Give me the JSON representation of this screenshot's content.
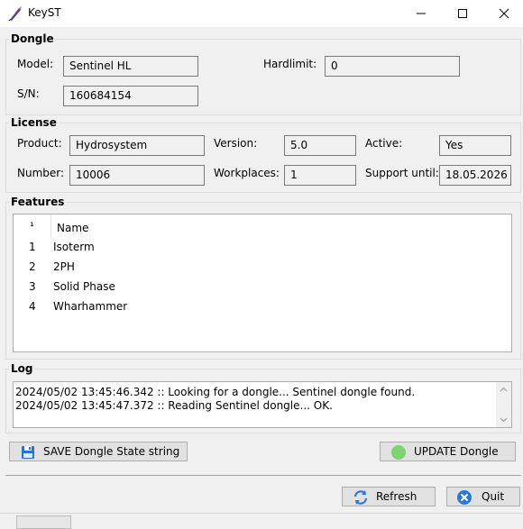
{
  "window": {
    "title": "KeyST",
    "app_icon": "quill-pen-icon",
    "controls": [
      "minimize-icon",
      "maximize-icon",
      "close-icon"
    ]
  },
  "dongle": {
    "legend": "Dongle",
    "model_label": "Model:",
    "model_value": "Sentinel HL",
    "sn_label": "S/N:",
    "sn_value": "160684154",
    "hardlimit_label": "Hardlimit:",
    "hardlimit_value": "0"
  },
  "license": {
    "legend": "License",
    "product_label": "Product:",
    "product_value": "Hydrosystem",
    "version_label": "Version:",
    "version_value": "5.0",
    "active_label": "Active:",
    "active_value": "Yes",
    "number_label": "Number:",
    "number_value": "10006",
    "workplaces_label": "Workplaces:",
    "workplaces_value": "1",
    "support_label": "Support until:",
    "support_value": "18.05.2026"
  },
  "features": {
    "legend": "Features",
    "columns": [
      "¹",
      "Name"
    ],
    "rows": [
      {
        "num": "1",
        "name": "Isoterm"
      },
      {
        "num": "2",
        "name": "2PH"
      },
      {
        "num": "3",
        "name": "Solid Phase"
      },
      {
        "num": "4",
        "name": "Wharhammer"
      }
    ]
  },
  "log": {
    "legend": "Log",
    "lines": [
      "2024/05/02 13:45:46.342 :: Looking for a dongle... Sentinel dongle found.",
      "2024/05/02 13:45:47.372 :: Reading Sentinel dongle... OK."
    ]
  },
  "buttons": {
    "save": {
      "label": "SAVE Dongle State string",
      "icon": "floppy-disk-icon"
    },
    "update": {
      "label": "UPDATE Dongle",
      "icon": "green-status-dot-icon",
      "color": "#7dd36f"
    },
    "refresh": {
      "label": "Refresh",
      "icon": "refresh-arrows-icon",
      "color": "#2b79d6"
    },
    "quit": {
      "label": "Quit",
      "icon": "close-circle-icon",
      "color": "#2b79d6"
    }
  }
}
